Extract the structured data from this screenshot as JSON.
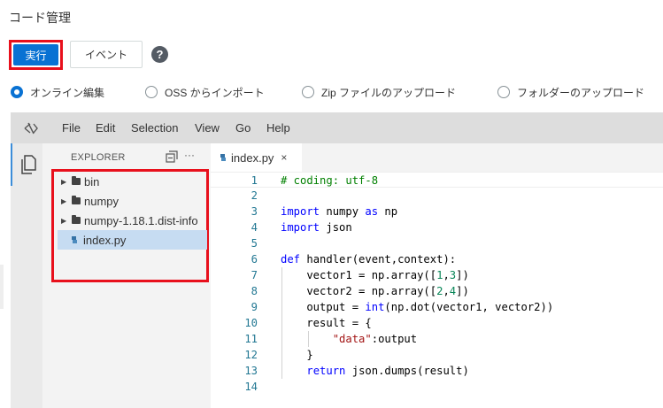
{
  "page": {
    "title": "コード管理"
  },
  "toolbar": {
    "run_label": "実行",
    "event_label": "イベント",
    "help_glyph": "?"
  },
  "source_options": [
    {
      "label": "オンライン編集",
      "checked": true
    },
    {
      "label": "OSS からインポート",
      "checked": false
    },
    {
      "label": "Zip ファイルのアップロード",
      "checked": false
    },
    {
      "label": "フォルダーのアップロード",
      "checked": false
    }
  ],
  "ide": {
    "menu": [
      "File",
      "Edit",
      "Selection",
      "View",
      "Go",
      "Help"
    ],
    "explorer": {
      "title": "EXPLORER",
      "more_glyph": "···",
      "items": [
        {
          "label": "bin",
          "type": "folder"
        },
        {
          "label": "numpy",
          "type": "folder"
        },
        {
          "label": "numpy-1.18.1.dist-info",
          "type": "folder"
        },
        {
          "label": "index.py",
          "type": "python-file",
          "selected": true
        }
      ]
    },
    "tab": {
      "label": "index.py",
      "close_glyph": "×"
    },
    "code_lines": [
      [
        [
          "c",
          "# coding: utf-8"
        ]
      ],
      [],
      [
        [
          "k",
          "import"
        ],
        [
          "p",
          " numpy "
        ],
        [
          "k",
          "as"
        ],
        [
          "p",
          " np"
        ]
      ],
      [
        [
          "k",
          "import"
        ],
        [
          "p",
          " json"
        ]
      ],
      [],
      [
        [
          "k",
          "def"
        ],
        [
          "p",
          " handler(event,context):"
        ]
      ],
      [
        [
          "p",
          "    vector1 = np.array(["
        ],
        [
          "n",
          "1"
        ],
        [
          "p",
          ","
        ],
        [
          "n",
          "3"
        ],
        [
          "p",
          "])"
        ]
      ],
      [
        [
          "p",
          "    vector2 = np.array(["
        ],
        [
          "n",
          "2"
        ],
        [
          "p",
          ","
        ],
        [
          "n",
          "4"
        ],
        [
          "p",
          "])"
        ]
      ],
      [
        [
          "p",
          "    output = "
        ],
        [
          "k",
          "int"
        ],
        [
          "p",
          "(np.dot(vector1, vector2))"
        ]
      ],
      [
        [
          "p",
          "    result = {"
        ]
      ],
      [
        [
          "p",
          "        "
        ],
        [
          "s",
          "\"data\""
        ],
        [
          "p",
          ":output"
        ]
      ],
      [
        [
          "p",
          "    }"
        ]
      ],
      [
        [
          "p",
          "    "
        ],
        [
          "k",
          "return"
        ],
        [
          "p",
          " json.dumps(result)"
        ]
      ],
      []
    ]
  },
  "colors": {
    "accent": "#0972d3",
    "highlight_box": "#e8101c",
    "selected_row": "#c6dcf2",
    "line_number": "#237893",
    "keyword": "#0000ff",
    "comment": "#008000",
    "string": "#a31515",
    "number": "#098658"
  }
}
